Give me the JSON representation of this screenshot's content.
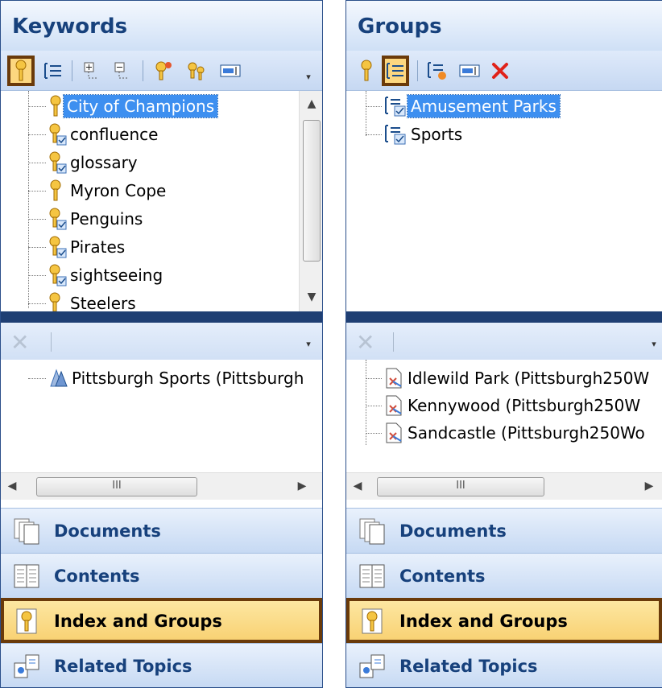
{
  "left_panel": {
    "title": "Keywords",
    "keywords": [
      "City of Champions",
      "confluence",
      "glossary",
      "Myron Cope",
      "Penguins",
      "Pirates",
      "sightseeing",
      "Steelers"
    ],
    "topics": [
      "Pittsburgh Sports (Pittsburgh"
    ],
    "scroll_mid_glyph": "III"
  },
  "right_panel": {
    "title": "Groups",
    "groups": [
      "Amusement Parks",
      "Sports"
    ],
    "topics": [
      "Idlewild Park (Pittsburgh250W",
      "Kennywood (Pittsburgh250W",
      "Sandcastle (Pittsburgh250Wo"
    ],
    "scroll_mid_glyph": "III"
  },
  "nav": {
    "documents": "Documents",
    "contents": "Contents",
    "index_and_groups": "Index and Groups",
    "related_topics": "Related Topics"
  },
  "colors": {
    "header_text": "#17417c",
    "selection": "#3d8ff0",
    "active_outline": "#6a3a0a",
    "active_fill": "#fcd780"
  }
}
